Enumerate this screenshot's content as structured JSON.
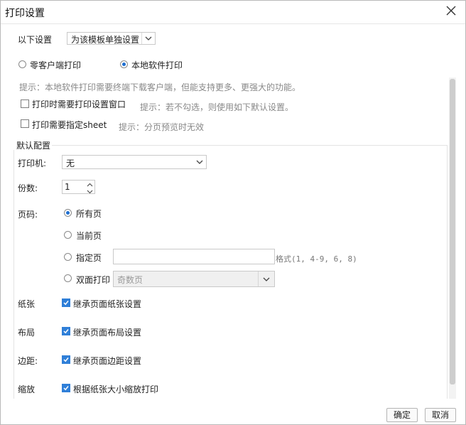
{
  "dialog": {
    "title": "打印设置",
    "close_icon": "close-icon"
  },
  "settings_scope": {
    "label": "以下设置",
    "value": "为该模板单独设置"
  },
  "print_mode": {
    "options": [
      {
        "label": "零客户端打印",
        "selected": false
      },
      {
        "label": "本地软件打印",
        "selected": true
      }
    ]
  },
  "hint_main": "提示：本地软件打印需要终端下载客户端，但能支持更多、更强大的功能。",
  "option_dialog": {
    "label": "打印时需要打印设置窗口",
    "checked": false,
    "hint": "提示：若不勾选，则使用如下默认设置。"
  },
  "option_sheet": {
    "label": "打印需要指定sheet",
    "checked": false,
    "hint": "提示：分页预览时无效"
  },
  "defaults": {
    "group_title": "默认配置",
    "printer": {
      "label": "打印机:",
      "value": "无"
    },
    "copies": {
      "label": "份数:",
      "value": "1"
    },
    "pages": {
      "label": "页码:",
      "all": "所有页",
      "current": "当前页",
      "specified": "指定页",
      "specified_value": "",
      "format_hint": "格式(1, 4-9, 6, 8)",
      "duplex": "双面打印",
      "duplex_value": "奇数页",
      "selected": "all"
    },
    "paper": {
      "label": "纸张",
      "checkbox": "继承页面纸张设置",
      "checked": true
    },
    "layout": {
      "label": "布局",
      "checkbox": "继承页面布局设置",
      "checked": true
    },
    "margin": {
      "label": "边距:",
      "checkbox": "继承页面边距设置",
      "checked": true
    },
    "scale": {
      "label": "缩放",
      "checkbox": "根据纸张大小缩放打印",
      "checked": true
    }
  },
  "buttons": {
    "ok": "确定",
    "cancel": "取消"
  },
  "colors": {
    "accent": "#2f7fd8",
    "hint": "#888888"
  }
}
